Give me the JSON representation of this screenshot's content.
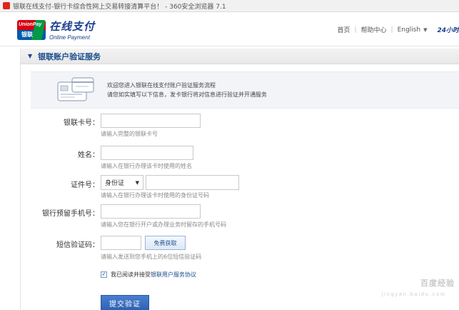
{
  "window": {
    "title": "银联在线支付-银行卡综合性网上交易转接清算平台！ - 360安全浏览器 7.1"
  },
  "header": {
    "logo": {
      "mark_top": "UnionPay",
      "mark_bottom": "银联",
      "cn": "在线支付",
      "en": "Online Payment"
    },
    "nav": {
      "home": "首页",
      "help": "帮助中心",
      "language": "English",
      "hotline": "24小时"
    }
  },
  "section": {
    "title": "银联账户验证服务"
  },
  "intro": {
    "line1": "欢迎您进入银联在线支付账户验证服务流程",
    "line2": "请您如实填写以下信息，发卡银行将对信息进行验证并开通服务"
  },
  "form": {
    "card": {
      "label": "银联卡号：",
      "value": "",
      "hint": "请输入完整的银联卡号"
    },
    "name": {
      "label": "姓名：",
      "value": "",
      "hint": "请输入在银行办理该卡时使用的姓名"
    },
    "id": {
      "label": "证件号：",
      "type_selected": "身份证",
      "value": "",
      "hint": "请输入在银行办理该卡时使用的身份证号码"
    },
    "phone": {
      "label": "银行预留手机号：",
      "value": "",
      "hint": "请输入您在银行开户或办理业务时留存的手机号码"
    },
    "sms": {
      "label": "短信验证码：",
      "value": "",
      "button": "免费获取",
      "hint": "请输入发送到您手机上的6位短信验证码"
    },
    "agree": {
      "checked": true,
      "text": "我已阅读并接受",
      "link": "银联用户服务协议"
    },
    "submit": "提交验证"
  },
  "watermark": {
    "main": "百度经验",
    "sub": "jingyan.baidu.com"
  },
  "colors": {
    "brand_blue": "#1a4b8c",
    "button_blue": "#2d5fb0",
    "unionpay_red": "#d7000f",
    "unionpay_green": "#009a44"
  }
}
